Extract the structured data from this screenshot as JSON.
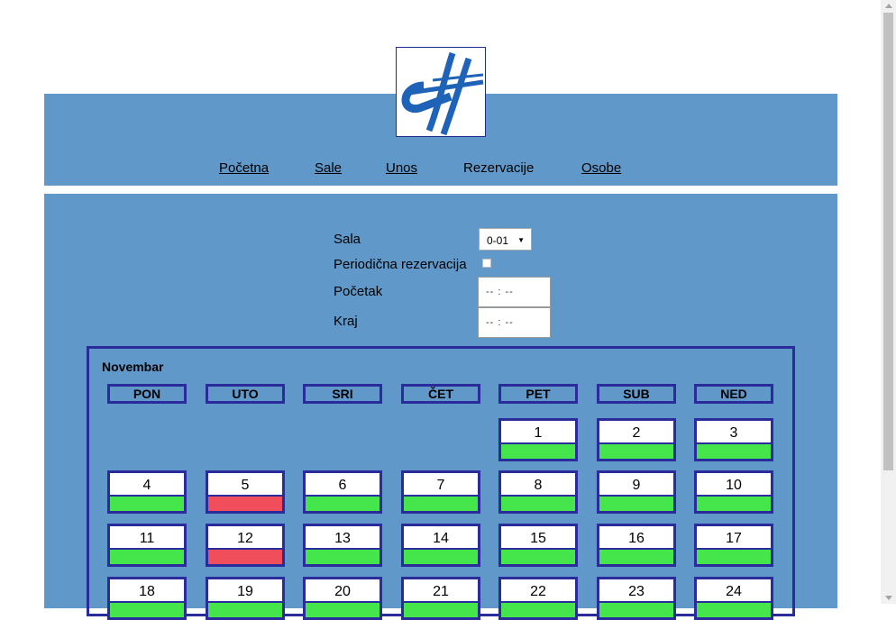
{
  "colors": {
    "band": "#5f98c9",
    "border": "#2a2c9b",
    "free": "#44e64b",
    "booked": "#f04e5a"
  },
  "nav": [
    {
      "label": "Početna",
      "link": true
    },
    {
      "label": "Sale",
      "link": true
    },
    {
      "label": "Unos",
      "link": true
    },
    {
      "label": "Rezervacije",
      "link": false
    },
    {
      "label": "Osobe",
      "link": true
    }
  ],
  "form": {
    "sala_label": "Sala",
    "sala_value": "0-01",
    "periodic_label": "Periodična rezervacija",
    "periodic_checked": false,
    "start_label": "Početak",
    "start_value": "-- : --",
    "end_label": "Kraj",
    "end_value": "-- : --"
  },
  "calendar": {
    "month": "Novembar",
    "weekdays": [
      "PON",
      "UTO",
      "SRI",
      "ČET",
      "PET",
      "SUB",
      "NED"
    ],
    "weeks": [
      [
        null,
        null,
        null,
        null,
        {
          "day": "1",
          "status": "free"
        },
        {
          "day": "2",
          "status": "free"
        },
        {
          "day": "3",
          "status": "free"
        }
      ],
      [
        {
          "day": "4",
          "status": "free"
        },
        {
          "day": "5",
          "status": "booked"
        },
        {
          "day": "6",
          "status": "free"
        },
        {
          "day": "7",
          "status": "free"
        },
        {
          "day": "8",
          "status": "free"
        },
        {
          "day": "9",
          "status": "free"
        },
        {
          "day": "10",
          "status": "free"
        }
      ],
      [
        {
          "day": "11",
          "status": "free"
        },
        {
          "day": "12",
          "status": "booked"
        },
        {
          "day": "13",
          "status": "free"
        },
        {
          "day": "14",
          "status": "free"
        },
        {
          "day": "15",
          "status": "free"
        },
        {
          "day": "16",
          "status": "free"
        },
        {
          "day": "17",
          "status": "free"
        }
      ],
      [
        {
          "day": "18",
          "status": "free"
        },
        {
          "day": "19",
          "status": "free"
        },
        {
          "day": "20",
          "status": "free"
        },
        {
          "day": "21",
          "status": "free"
        },
        {
          "day": "22",
          "status": "free"
        },
        {
          "day": "23",
          "status": "free"
        },
        {
          "day": "24",
          "status": "free"
        }
      ]
    ]
  }
}
